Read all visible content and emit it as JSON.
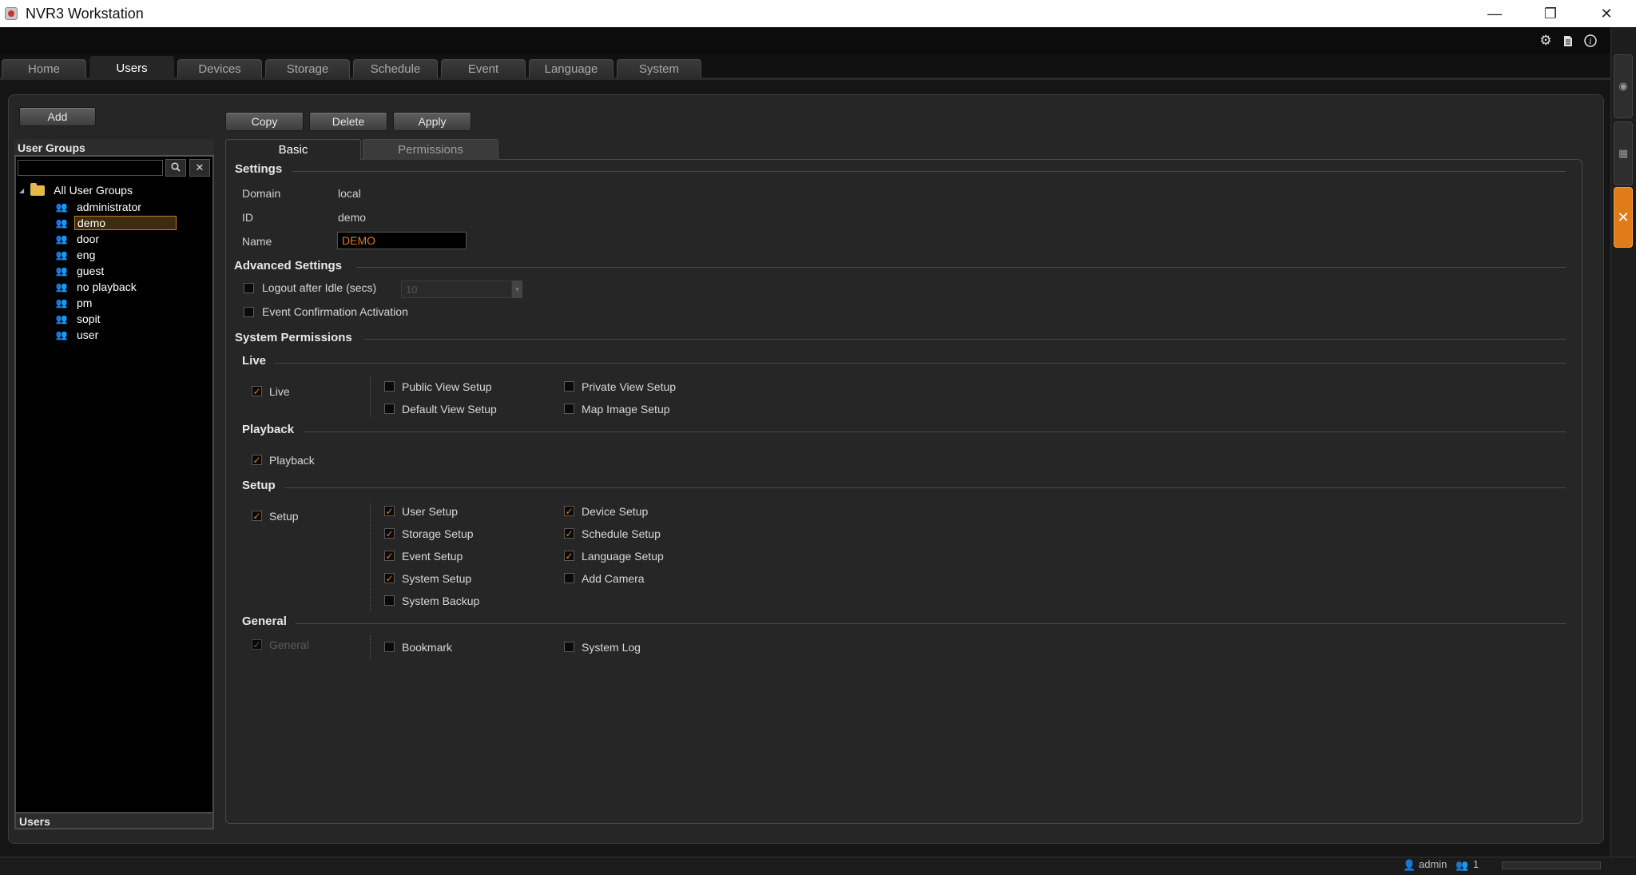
{
  "window": {
    "title": "NVR3 Workstation",
    "minimize_glyph": "—",
    "restore_glyph": "❐",
    "close_glyph": "✕"
  },
  "top_icons": [
    "gear-icon",
    "document-icon",
    "info-icon"
  ],
  "main_tabs": [
    {
      "label": "Home"
    },
    {
      "label": "Users"
    },
    {
      "label": "Devices"
    },
    {
      "label": "Storage"
    },
    {
      "label": "Schedule"
    },
    {
      "label": "Event"
    },
    {
      "label": "Language"
    },
    {
      "label": "System"
    }
  ],
  "active_main_tab": "Users",
  "left": {
    "add_label": "Add",
    "groups_header": "User Groups",
    "search_value": "",
    "tree_root": "All User Groups",
    "groups": [
      "administrator",
      "demo",
      "door",
      "eng",
      "guest",
      "no playback",
      "pm",
      "sopit",
      "user"
    ],
    "selected_group": "demo",
    "users_footer": "Users"
  },
  "toolbar": {
    "copy_label": "Copy",
    "delete_label": "Delete",
    "apply_label": "Apply"
  },
  "subtabs": {
    "basic": "Basic",
    "permissions": "Permissions"
  },
  "settings": {
    "title": "Settings",
    "domain_label": "Domain",
    "domain_value": "local",
    "id_label": "ID",
    "id_value": "demo",
    "name_label": "Name",
    "name_value": "DEMO"
  },
  "advanced": {
    "title": "Advanced Settings",
    "logout_label": "Logout after Idle (secs)",
    "logout_checked": false,
    "idle_value": "10",
    "event_confirm_label": "Event Confirmation Activation",
    "event_confirm_checked": false
  },
  "system_permissions": {
    "title": "System Permissions",
    "live": {
      "title": "Live",
      "main": {
        "label": "Live",
        "checked": true
      },
      "items": [
        {
          "label": "Public View Setup",
          "checked": false
        },
        {
          "label": "Private View Setup",
          "checked": false
        },
        {
          "label": "Default View Setup",
          "checked": false
        },
        {
          "label": "Map Image Setup",
          "checked": false
        }
      ]
    },
    "playback": {
      "title": "Playback",
      "main": {
        "label": "Playback",
        "checked": true
      }
    },
    "setup": {
      "title": "Setup",
      "main": {
        "label": "Setup",
        "checked": true
      },
      "items": [
        {
          "label": "User Setup",
          "checked": true
        },
        {
          "label": "Device Setup",
          "checked": true
        },
        {
          "label": "Storage Setup",
          "checked": true
        },
        {
          "label": "Schedule Setup",
          "checked": true
        },
        {
          "label": "Event Setup",
          "checked": true
        },
        {
          "label": "Language Setup",
          "checked": true
        },
        {
          "label": "System Setup",
          "checked": true
        },
        {
          "label": "Add Camera",
          "checked": false
        },
        {
          "label": "System Backup",
          "checked": false
        }
      ]
    },
    "general": {
      "title": "General",
      "main": {
        "label": "General",
        "checked": true,
        "disabled": true
      },
      "items": [
        {
          "label": "Bookmark",
          "checked": false
        },
        {
          "label": "System Log",
          "checked": false
        }
      ]
    }
  },
  "status": {
    "user": "admin",
    "sessions": "1"
  },
  "colors": {
    "accent": "#e07b1a",
    "background": "#262626",
    "panel_black": "#000000"
  }
}
